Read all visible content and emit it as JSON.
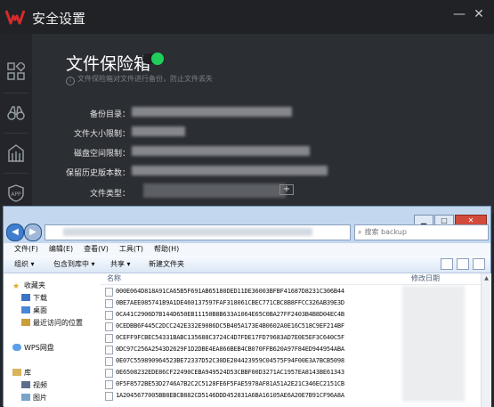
{
  "app": {
    "title": "安全设置",
    "brand_color": "#d42b2b",
    "window_controls": [
      "minimize-icon",
      "close-icon"
    ]
  },
  "sidebar": {
    "items": [
      {
        "icon": "apps-grid-icon"
      },
      {
        "icon": "binoculars-icon"
      },
      {
        "icon": "shield-icon"
      },
      {
        "icon": "app-shield-icon",
        "label": "APP"
      }
    ]
  },
  "vault": {
    "title": "文件保险箱",
    "enabled": true,
    "toggle_color": "#1fcf5a",
    "description": "文件保险箱对文件进行备份，防止文件丢失",
    "fields": [
      {
        "label": "备份目录："
      },
      {
        "label": "文件大小限制："
      },
      {
        "label": "磁盘空间限制："
      },
      {
        "label": "保留历史版本数："
      },
      {
        "label": "文件类型："
      }
    ],
    "add_symbol": "+"
  },
  "explorer": {
    "search_placeholder": "搜索 backup",
    "menu": [
      "文件(F)",
      "编辑(E)",
      "查看(V)",
      "工具(T)",
      "帮助(H)"
    ],
    "toolbar": {
      "organize": "组织 ▾",
      "include": "包含到库中 ▾",
      "share": "共享 ▾",
      "new_folder": "新建文件夹"
    },
    "nav": {
      "favorites": "收藏夹",
      "downloads": "下载",
      "desktop": "桌面",
      "recent": "最近访问的位置",
      "wps": "WPS网盘",
      "libraries": "库",
      "videos": "视频",
      "pictures": "图片"
    },
    "columns": {
      "name": "名称",
      "modified": "修改日期"
    },
    "files": [
      "000E064D818A91CA65B5F691AB65180DED11DE36003BFBF41687D8231C306B44",
      "0BE7AEE085741B9A1DE460137597FAF318061CBEC771CBC8B8FFCC326AB39E3D",
      "0CA41C2906D7B144D650EB11150B8B633A1064E65C0BA27FF2403B4B8D04EC4B",
      "0CEDBB6F445C2DCC242E332E9086DC5B405A173E4B0602A0E16C518C9EF214BF",
      "0CEFF9FCBEC54331BABC135688C3724C4D7FDE17FD79683AD7E0E5EF3C640C5F",
      "0DC97C256A2543D2629F1D2DBE4EA866BEB4CB070FFB620A97F84ED944954ABA",
      "0E07C559890964523BE72337D52C30DE204423959C04575F94F00E3A7BCB5098",
      "0E6508232EDE86CF22490CEBA949524D53CBBF00D3271AC1957EA8143BE61343",
      "0F5F8572BE53D2746A7B2C2C5128FE6F5FAE5978AF81A51A2E21C346EC2151CB",
      "1A2045677005BB8EBCB882CD5146DDD452831A6BA16105AE6A20E7B91CF96A8A"
    ]
  }
}
